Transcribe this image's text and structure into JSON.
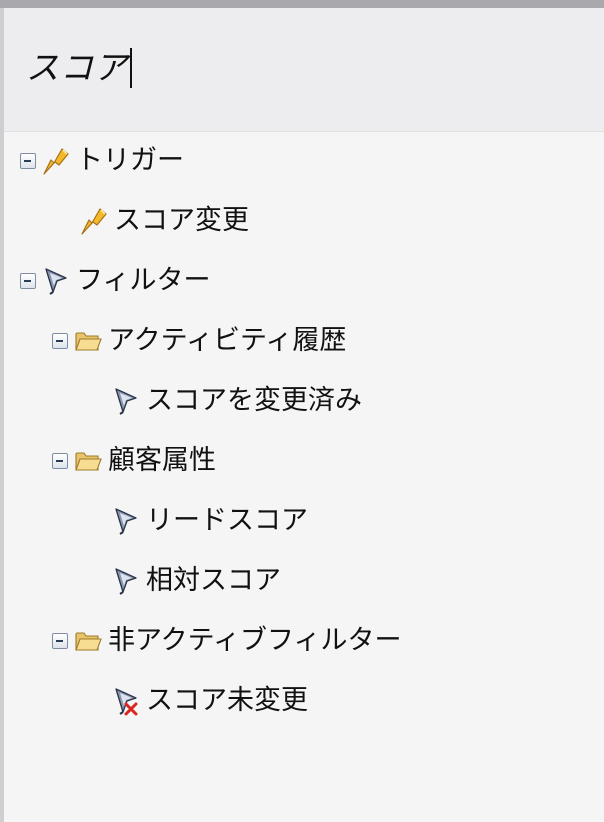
{
  "search": {
    "value": "スコア"
  },
  "tree": {
    "triggers": {
      "label": "トリガー",
      "icon": "trigger-icon",
      "children": [
        {
          "label": "スコア変更",
          "icon": "trigger-icon"
        }
      ]
    },
    "filters": {
      "label": "フィルター",
      "icon": "filter-icon",
      "groups": [
        {
          "label": "アクティビティ履歴",
          "icon": "folder-icon",
          "items": [
            {
              "label": "スコアを変更済み",
              "icon": "filter-icon"
            }
          ]
        },
        {
          "label": "顧客属性",
          "icon": "folder-icon",
          "items": [
            {
              "label": "リードスコア",
              "icon": "filter-icon"
            },
            {
              "label": "相対スコア",
              "icon": "filter-icon"
            }
          ]
        },
        {
          "label": "非アクティブフィルター",
          "icon": "folder-icon",
          "items": [
            {
              "label": "スコア未変更",
              "icon": "inactive-filter-icon"
            }
          ]
        }
      ]
    }
  },
  "colors": {
    "top_bar": "#a9a8ad",
    "search_background": "#ededf0",
    "tree_background": "#f5f5f5",
    "inactive_mark": "#d9251d"
  }
}
